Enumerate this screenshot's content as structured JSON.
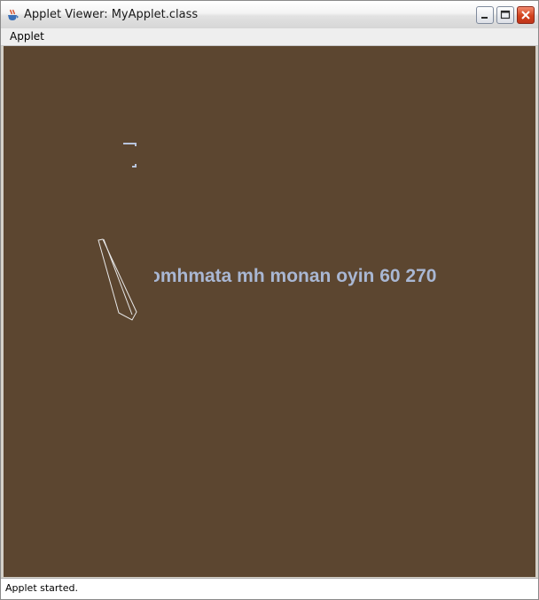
{
  "window": {
    "title": "Applet Viewer: MyApplet.class",
    "icon": "java-cup-icon"
  },
  "menubar": {
    "items": [
      {
        "label": "Applet"
      }
    ]
  },
  "canvas": {
    "background_color": "#5c4630",
    "text": "omhmata mh monan oyin 60 270",
    "text_color": "#a9b7d3",
    "stroke_color": "#e8e8e8"
  },
  "status": {
    "text": "Applet started."
  }
}
